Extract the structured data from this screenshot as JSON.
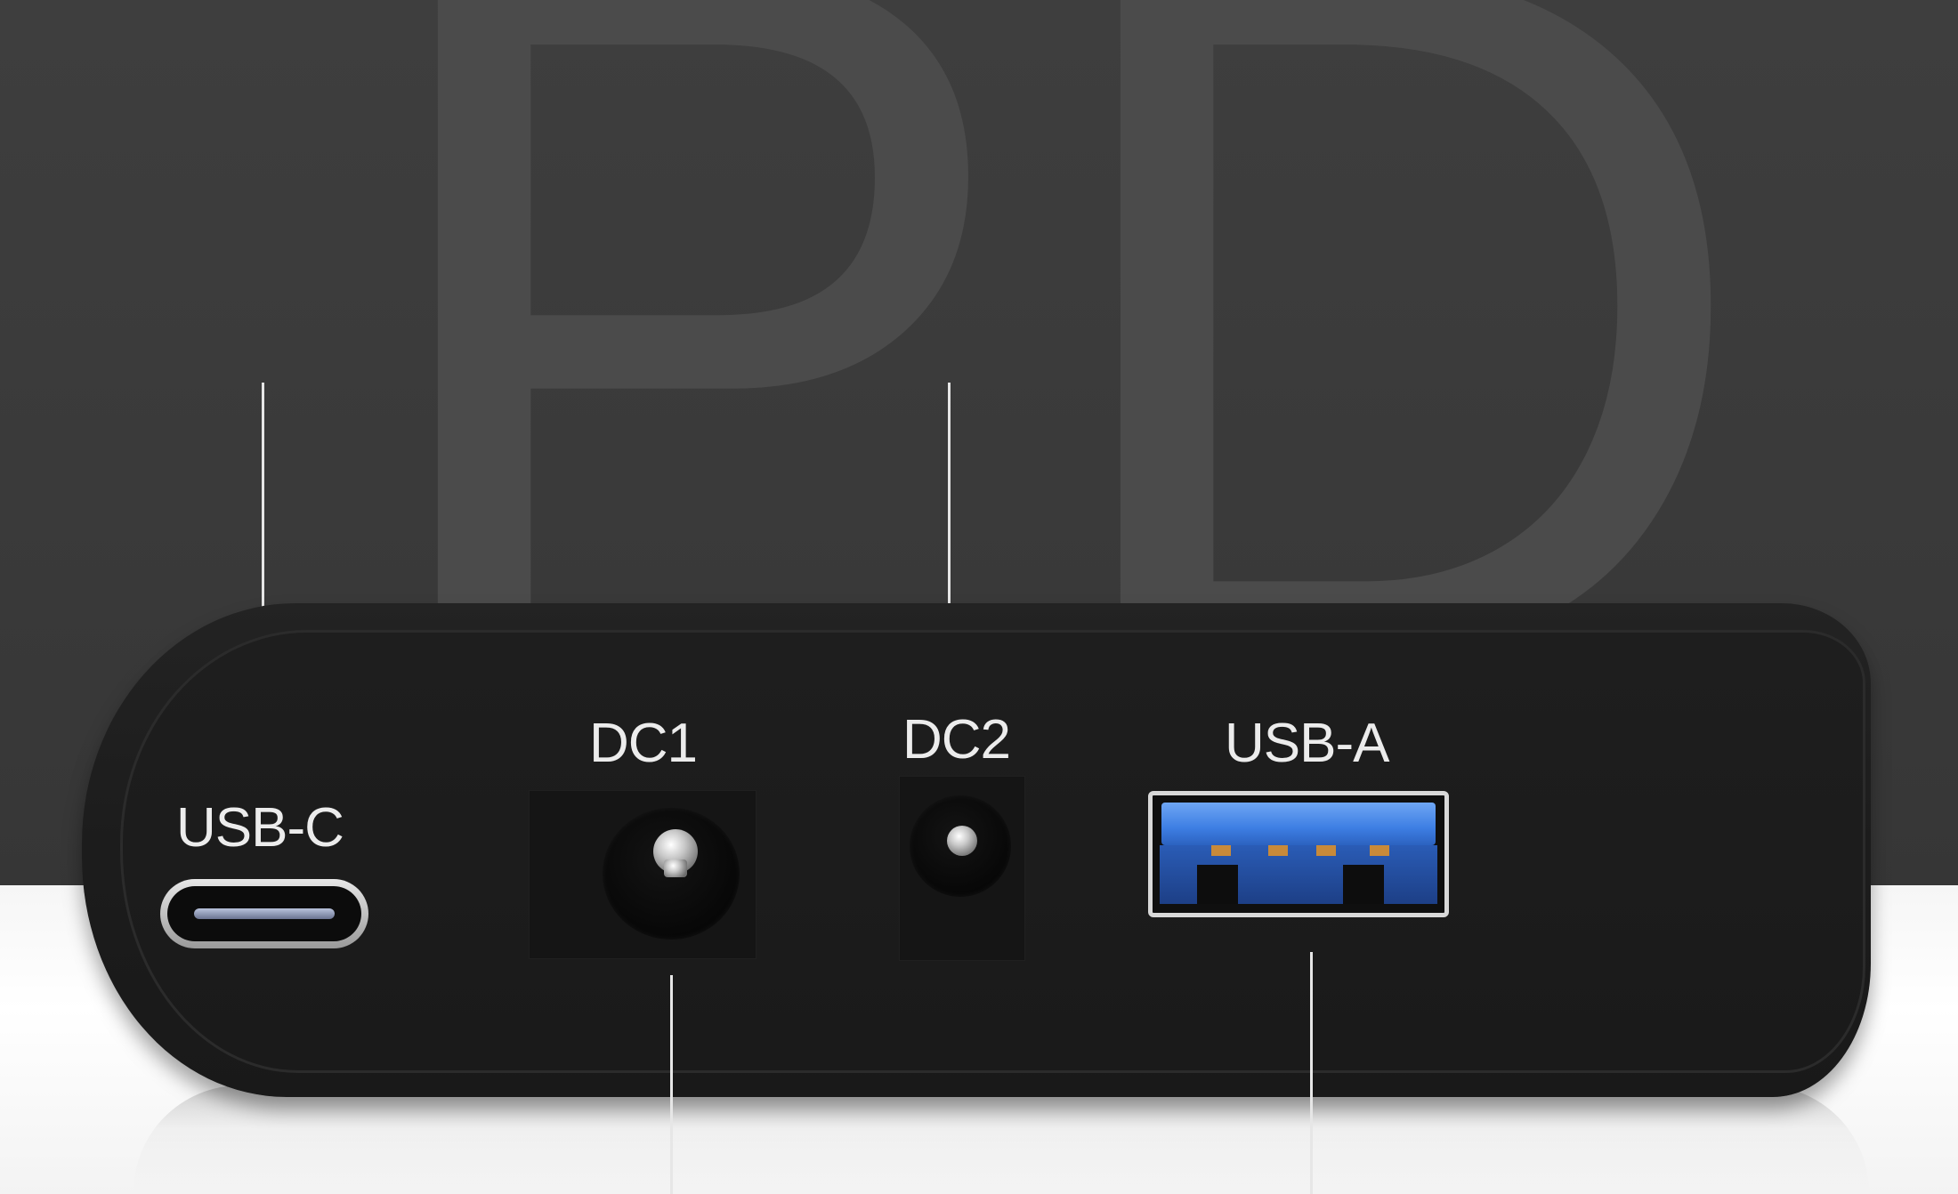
{
  "watermark": {
    "text": "PD"
  },
  "ports": {
    "usb_c": {
      "label": "USB-C"
    },
    "dc1": {
      "label": "DC1"
    },
    "dc2": {
      "label": "DC2"
    },
    "usb_a": {
      "label": "USB-A"
    }
  },
  "colors": {
    "background": "#3a3a3a",
    "device": "#1c1c1c",
    "label_text": "#ececec",
    "usb_a_insert": "#3d7ee3",
    "floor": "#ffffff"
  },
  "icons": [
    "usb-c-port-icon",
    "dc-jack-icon",
    "usb-a-port-icon"
  ]
}
